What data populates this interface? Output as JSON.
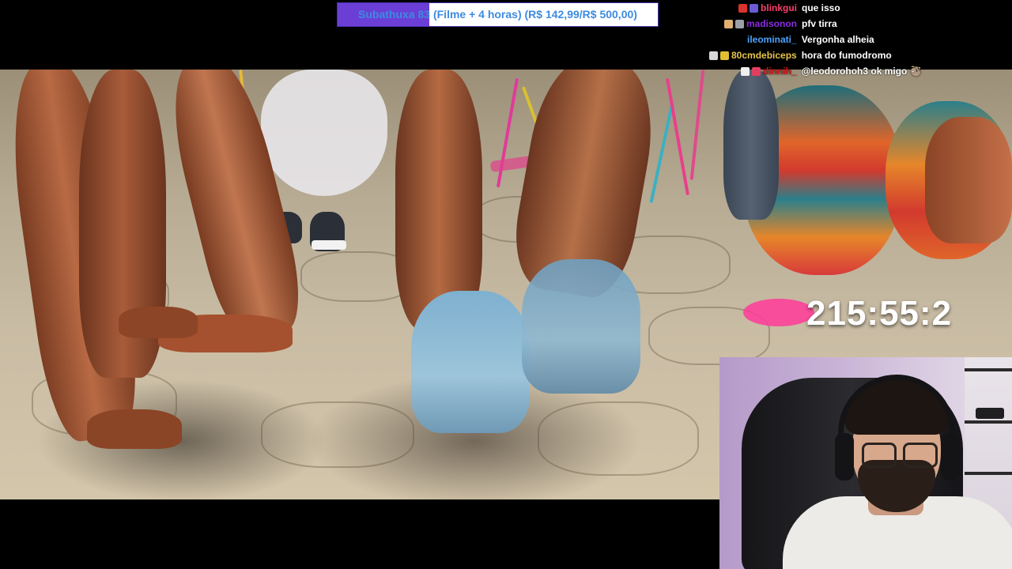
{
  "goal": {
    "text": "Subathuxa 83 (Filme + 4 horas) (R$ 142,99/R$ 500,00)",
    "progress_fraction": 0.286,
    "fill_color": "#6b3fd6",
    "text_color": "#3d8be0"
  },
  "chat": [
    {
      "user": "blinkgui",
      "message": "que isso",
      "user_color": "#ff3b6b",
      "badges": [
        "#d9332e",
        "#6b5bd6"
      ]
    },
    {
      "user": "madisonon",
      "message": "pfv tirra",
      "user_color": "#8a2be2",
      "badges": [
        "#e0b070",
        "#9aa0a6"
      ]
    },
    {
      "user": "ileominati_",
      "message": "Vergonha alheia",
      "user_color": "#4aa3ff",
      "badges": []
    },
    {
      "user": "80cmdebiceps",
      "message": "hora do fumodromo",
      "user_color": "#e6c44a",
      "badges": [
        "#d8d8d8",
        "#e0c030"
      ]
    },
    {
      "user": "dinnih_",
      "message": "@leodorohoh3 ok migo",
      "user_color": "#d01818",
      "badges": [
        "#f0f0f0",
        "#e04060"
      ],
      "emote": "🦥"
    }
  ],
  "timer": "215:55:2",
  "video": {
    "name": "movie-scene"
  },
  "webcam": {
    "name": "streamer-webcam"
  }
}
